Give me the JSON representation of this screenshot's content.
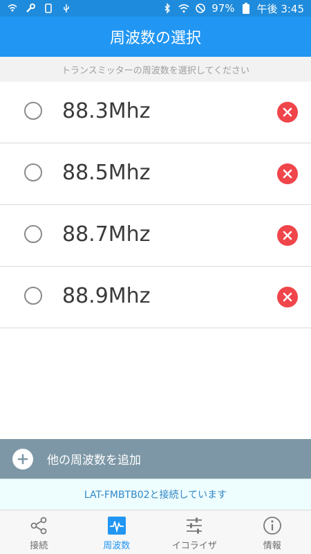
{
  "status_bar": {
    "battery": "97%",
    "time": "午後 3:45",
    "left_icons": [
      "wifi-calling-icon",
      "wrench-icon",
      "phone-icon",
      "usb-icon"
    ],
    "right_icons": [
      "bluetooth-icon",
      "wifi-icon",
      "block-icon",
      "battery-icon"
    ]
  },
  "header": {
    "title": "周波数の選択"
  },
  "subtitle": "トランスミッターの周波数を選択してください",
  "frequencies": [
    {
      "label": "88.3Mhz",
      "selected": false
    },
    {
      "label": "88.5Mhz",
      "selected": false
    },
    {
      "label": "88.7Mhz",
      "selected": false
    },
    {
      "label": "88.9Mhz",
      "selected": false
    }
  ],
  "add_button": {
    "label": "他の周波数を追加"
  },
  "connection_status": "LAT-FMBTB02と接続しています",
  "bottom_nav": [
    {
      "label": "接続",
      "icon": "share-icon",
      "active": false
    },
    {
      "label": "周波数",
      "icon": "waveform-icon",
      "active": true
    },
    {
      "label": "イコライザ",
      "icon": "equalizer-icon",
      "active": false
    },
    {
      "label": "情報",
      "icon": "info-icon",
      "active": false
    }
  ],
  "colors": {
    "status_bar": "#1f8bdc",
    "app_bar": "#2196f3",
    "delete": "#f0454a",
    "add_bar": "#7d97a6",
    "connection_text": "#2f86c8"
  }
}
